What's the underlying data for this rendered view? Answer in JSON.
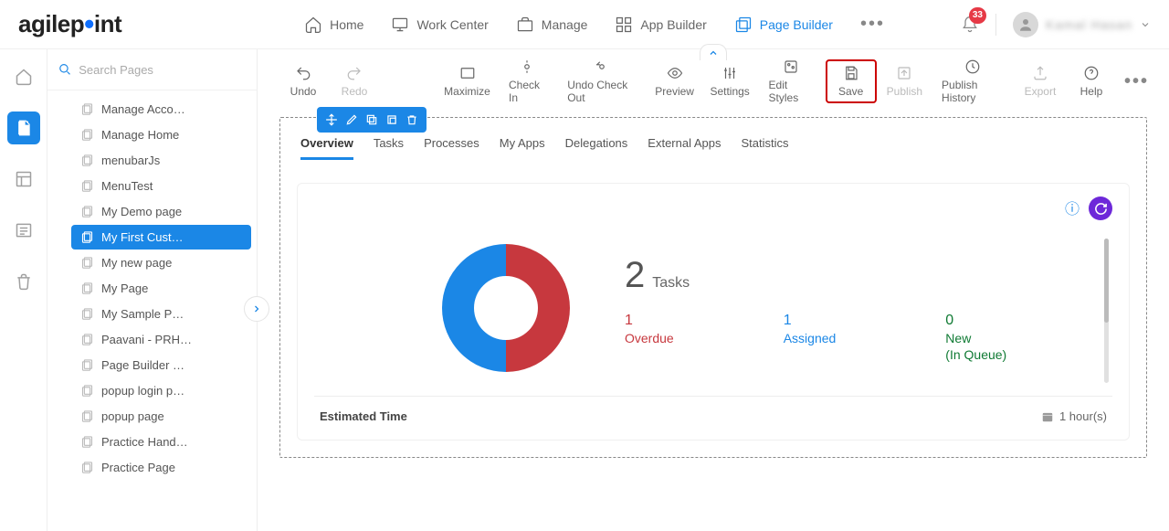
{
  "brand": {
    "name": "agilepoint"
  },
  "topnav": [
    {
      "label": "Home",
      "icon": "home-icon"
    },
    {
      "label": "Work Center",
      "icon": "monitor-icon"
    },
    {
      "label": "Manage",
      "icon": "briefcase-icon"
    },
    {
      "label": "App Builder",
      "icon": "grid-icon"
    },
    {
      "label": "Page Builder",
      "icon": "pages-icon",
      "active": true
    }
  ],
  "notifications": {
    "count": "33"
  },
  "user": {
    "display_name": "Kamal Hasan"
  },
  "search": {
    "placeholder": "Search Pages"
  },
  "page_tree": [
    {
      "label": "Manage Acco…"
    },
    {
      "label": "Manage Home"
    },
    {
      "label": "menubarJs"
    },
    {
      "label": "MenuTest"
    },
    {
      "label": "My Demo page"
    },
    {
      "label": "My First Cust…",
      "selected": true
    },
    {
      "label": "My new page"
    },
    {
      "label": "My Page"
    },
    {
      "label": "My Sample P…"
    },
    {
      "label": "Paavani - PRH…"
    },
    {
      "label": "Page Builder …"
    },
    {
      "label": "popup login p…"
    },
    {
      "label": "popup page"
    },
    {
      "label": "Practice Hand…"
    },
    {
      "label": "Practice Page"
    }
  ],
  "toolbar": {
    "undo": "Undo",
    "redo": "Redo",
    "maximize": "Maximize",
    "checkin": "Check In",
    "undo_checkout": "Undo Check Out",
    "preview": "Preview",
    "settings": "Settings",
    "edit_styles": "Edit Styles",
    "save": "Save",
    "publish": "Publish",
    "publish_history": "Publish History",
    "export": "Export",
    "help": "Help"
  },
  "tabs": [
    {
      "label": "Overview",
      "active": true
    },
    {
      "label": "Tasks"
    },
    {
      "label": "Processes"
    },
    {
      "label": "My Apps"
    },
    {
      "label": "Delegations"
    },
    {
      "label": "External Apps"
    },
    {
      "label": "Statistics"
    }
  ],
  "widget": {
    "task_count": "2",
    "task_label": "Tasks",
    "stats": {
      "overdue": {
        "num": "1",
        "label": "Overdue"
      },
      "assigned": {
        "num": "1",
        "label": "Assigned"
      },
      "new_q": {
        "num": "0",
        "label1": "New",
        "label2": "(In Queue)"
      }
    },
    "estimated_label": "Estimated Time",
    "estimated_value": "1 hour(s)"
  },
  "chart_data": {
    "type": "pie",
    "title": "Tasks",
    "series": [
      {
        "name": "Overdue",
        "value": 1,
        "color": "#c7383e"
      },
      {
        "name": "Assigned",
        "value": 1,
        "color": "#1b87e6"
      }
    ]
  }
}
